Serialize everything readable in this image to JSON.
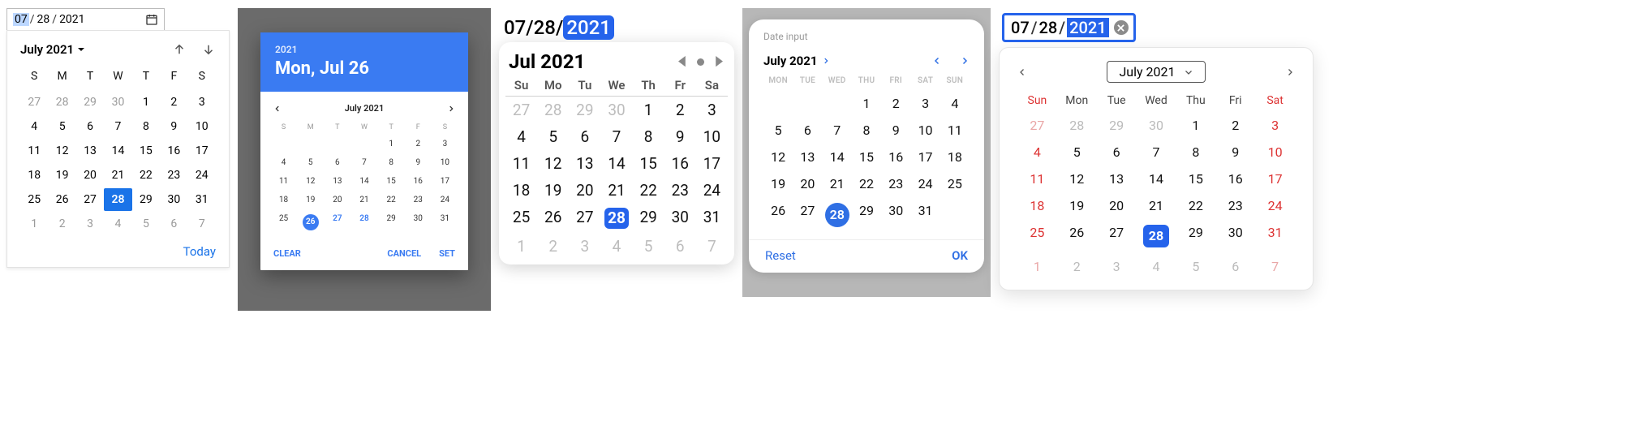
{
  "panel1": {
    "input": {
      "month": "07",
      "day": "28",
      "year": "2021",
      "selected_segment": "month"
    },
    "header_label": "July 2021",
    "today_label": "Today",
    "day_headers": [
      "S",
      "M",
      "T",
      "W",
      "T",
      "F",
      "S"
    ],
    "weeks": [
      [
        {
          "d": "27",
          "out": true
        },
        {
          "d": "28",
          "out": true
        },
        {
          "d": "29",
          "out": true
        },
        {
          "d": "30",
          "out": true
        },
        {
          "d": "1"
        },
        {
          "d": "2"
        },
        {
          "d": "3"
        }
      ],
      [
        {
          "d": "4"
        },
        {
          "d": "5"
        },
        {
          "d": "6"
        },
        {
          "d": "7"
        },
        {
          "d": "8"
        },
        {
          "d": "9"
        },
        {
          "d": "10"
        }
      ],
      [
        {
          "d": "11"
        },
        {
          "d": "12"
        },
        {
          "d": "13"
        },
        {
          "d": "14"
        },
        {
          "d": "15"
        },
        {
          "d": "16"
        },
        {
          "d": "17"
        }
      ],
      [
        {
          "d": "18"
        },
        {
          "d": "19"
        },
        {
          "d": "20"
        },
        {
          "d": "21"
        },
        {
          "d": "22"
        },
        {
          "d": "23"
        },
        {
          "d": "24"
        }
      ],
      [
        {
          "d": "25"
        },
        {
          "d": "26"
        },
        {
          "d": "27"
        },
        {
          "d": "28",
          "sel": true
        },
        {
          "d": "29"
        },
        {
          "d": "30"
        },
        {
          "d": "31"
        }
      ],
      [
        {
          "d": "1",
          "out": true
        },
        {
          "d": "2",
          "out": true
        },
        {
          "d": "3",
          "out": true
        },
        {
          "d": "4",
          "out": true
        },
        {
          "d": "5",
          "out": true
        },
        {
          "d": "6",
          "out": true
        },
        {
          "d": "7",
          "out": true
        }
      ]
    ]
  },
  "panel2": {
    "banner_year": "2021",
    "banner_date": "Mon, Jul 26",
    "month_label": "July 2021",
    "clear_label": "CLEAR",
    "cancel_label": "CANCEL",
    "set_label": "SET",
    "day_headers": [
      "S",
      "M",
      "T",
      "W",
      "T",
      "F",
      "S"
    ],
    "weeks": [
      [
        "",
        "",
        "",
        "",
        "1",
        "2",
        "3"
      ],
      [
        "4",
        "5",
        "6",
        "7",
        "8",
        "9",
        "10"
      ],
      [
        "11",
        "12",
        "13",
        "14",
        "15",
        "16",
        "17"
      ],
      [
        "18",
        "19",
        "20",
        "21",
        "22",
        "23",
        "24"
      ],
      [
        "25",
        "26",
        "27",
        "28",
        "29",
        "30",
        "31"
      ]
    ],
    "selected_day": "26",
    "accent_days": [
      "27",
      "28"
    ]
  },
  "panel3": {
    "input": {
      "month": "07",
      "day": "28",
      "year": "2021",
      "selected_segment": "year"
    },
    "header_label": "Jul 2021",
    "day_headers": [
      "Su",
      "Mo",
      "Tu",
      "We",
      "Th",
      "Fr",
      "Sa"
    ],
    "weeks": [
      [
        {
          "d": "27",
          "out": true
        },
        {
          "d": "28",
          "out": true
        },
        {
          "d": "29",
          "out": true
        },
        {
          "d": "30",
          "out": true
        },
        {
          "d": "1"
        },
        {
          "d": "2"
        },
        {
          "d": "3"
        }
      ],
      [
        {
          "d": "4"
        },
        {
          "d": "5"
        },
        {
          "d": "6"
        },
        {
          "d": "7"
        },
        {
          "d": "8"
        },
        {
          "d": "9"
        },
        {
          "d": "10"
        }
      ],
      [
        {
          "d": "11"
        },
        {
          "d": "12"
        },
        {
          "d": "13"
        },
        {
          "d": "14"
        },
        {
          "d": "15"
        },
        {
          "d": "16"
        },
        {
          "d": "17"
        }
      ],
      [
        {
          "d": "18"
        },
        {
          "d": "19"
        },
        {
          "d": "20"
        },
        {
          "d": "21"
        },
        {
          "d": "22"
        },
        {
          "d": "23"
        },
        {
          "d": "24"
        }
      ],
      [
        {
          "d": "25"
        },
        {
          "d": "26"
        },
        {
          "d": "27"
        },
        {
          "d": "28",
          "sel": true
        },
        {
          "d": "29"
        },
        {
          "d": "30"
        },
        {
          "d": "31"
        }
      ],
      [
        {
          "d": "1",
          "out": true
        },
        {
          "d": "2",
          "out": true
        },
        {
          "d": "3",
          "out": true
        },
        {
          "d": "4",
          "out": true
        },
        {
          "d": "5",
          "out": true
        },
        {
          "d": "6",
          "out": true
        },
        {
          "d": "7",
          "out": true
        }
      ]
    ]
  },
  "panel4": {
    "field_label": "Date input",
    "month_label": "July 2021",
    "reset_label": "Reset",
    "ok_label": "OK",
    "day_headers": [
      "MON",
      "TUE",
      "WED",
      "THU",
      "FRI",
      "SAT",
      "SUN"
    ],
    "weeks": [
      [
        "",
        "",
        "",
        "1",
        "2",
        "3",
        "4"
      ],
      [
        "5",
        "6",
        "7",
        "8",
        "9",
        "10",
        "11"
      ],
      [
        "12",
        "13",
        "14",
        "15",
        "16",
        "17",
        "18"
      ],
      [
        "19",
        "20",
        "21",
        "22",
        "23",
        "24",
        "25"
      ],
      [
        "26",
        "27",
        "28",
        "29",
        "30",
        "31",
        ""
      ]
    ],
    "selected_day": "28"
  },
  "panel5": {
    "input": {
      "month": "07",
      "day": "28",
      "year": "2021",
      "selected_segment": "year"
    },
    "month_label": "July 2021",
    "day_headers": [
      "Sun",
      "Mon",
      "Tue",
      "Wed",
      "Thu",
      "Fri",
      "Sat"
    ],
    "weekend_cols": [
      0,
      6
    ],
    "weeks": [
      [
        {
          "d": "27",
          "out": true
        },
        {
          "d": "28",
          "out": true
        },
        {
          "d": "29",
          "out": true
        },
        {
          "d": "30",
          "out": true
        },
        {
          "d": "1"
        },
        {
          "d": "2"
        },
        {
          "d": "3"
        }
      ],
      [
        {
          "d": "4"
        },
        {
          "d": "5"
        },
        {
          "d": "6"
        },
        {
          "d": "7"
        },
        {
          "d": "8"
        },
        {
          "d": "9"
        },
        {
          "d": "10"
        }
      ],
      [
        {
          "d": "11"
        },
        {
          "d": "12"
        },
        {
          "d": "13"
        },
        {
          "d": "14"
        },
        {
          "d": "15"
        },
        {
          "d": "16"
        },
        {
          "d": "17"
        }
      ],
      [
        {
          "d": "18"
        },
        {
          "d": "19"
        },
        {
          "d": "20"
        },
        {
          "d": "21"
        },
        {
          "d": "22"
        },
        {
          "d": "23"
        },
        {
          "d": "24"
        }
      ],
      [
        {
          "d": "25"
        },
        {
          "d": "26"
        },
        {
          "d": "27"
        },
        {
          "d": "28",
          "sel": true
        },
        {
          "d": "29"
        },
        {
          "d": "30"
        },
        {
          "d": "31"
        }
      ],
      [
        {
          "d": "1",
          "out": true
        },
        {
          "d": "2",
          "out": true
        },
        {
          "d": "3",
          "out": true
        },
        {
          "d": "4",
          "out": true
        },
        {
          "d": "5",
          "out": true
        },
        {
          "d": "6",
          "out": true
        },
        {
          "d": "7",
          "out": true
        }
      ]
    ]
  }
}
